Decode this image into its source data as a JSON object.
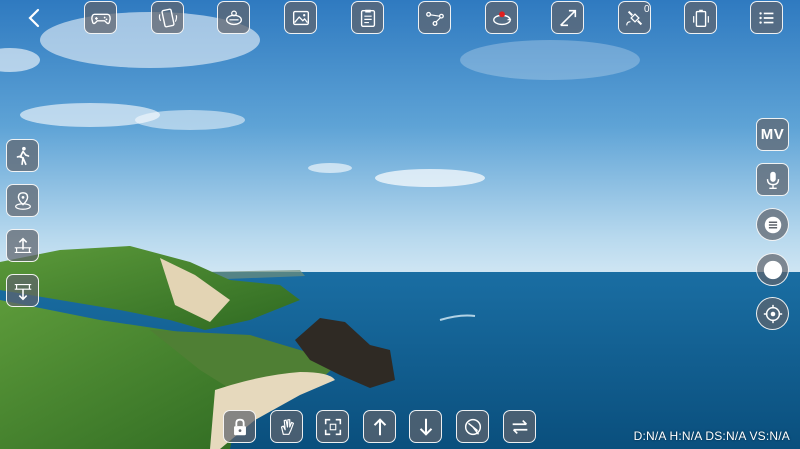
{
  "top_bar": {
    "back_icon": "chevron-left-icon",
    "buttons": [
      {
        "icon": "gamepad-icon"
      },
      {
        "icon": "phone-tilt-icon"
      },
      {
        "icon": "gesture-drone-icon"
      },
      {
        "icon": "gallery-icon"
      },
      {
        "icon": "checklist-icon"
      },
      {
        "icon": "waypoint-path-icon"
      },
      {
        "icon": "orbit-icon"
      },
      {
        "icon": "calibrate-icon"
      },
      {
        "icon": "satellite-icon",
        "count": "0"
      },
      {
        "icon": "battery-icon"
      },
      {
        "icon": "menu-icon"
      }
    ]
  },
  "left_bar": {
    "buttons": [
      {
        "icon": "follow-me-icon"
      },
      {
        "icon": "return-home-icon"
      },
      {
        "icon": "takeoff-icon"
      },
      {
        "icon": "landing-icon"
      }
    ]
  },
  "right_bar": {
    "mv_label": "MV",
    "buttons": [
      {
        "icon": "microphone-icon"
      },
      {
        "icon": "list-circle-icon"
      },
      {
        "icon": "record-icon"
      },
      {
        "icon": "target-icon"
      }
    ]
  },
  "bottom_bar": {
    "buttons": [
      {
        "icon": "lock-icon"
      },
      {
        "icon": "hand-gesture-icon"
      },
      {
        "icon": "focus-frame-icon"
      },
      {
        "icon": "arrow-up-icon"
      },
      {
        "icon": "arrow-down-icon"
      },
      {
        "icon": "drone-gauge-icon"
      },
      {
        "icon": "swap-icon"
      }
    ]
  },
  "telemetry": "D:N/A H:N/A DS:N/A VS:N/A",
  "colors": {
    "button_bg": "#5f646c",
    "button_border": "#ffffff",
    "record_dot": "#e02020",
    "sea": "#0d5a8a"
  }
}
